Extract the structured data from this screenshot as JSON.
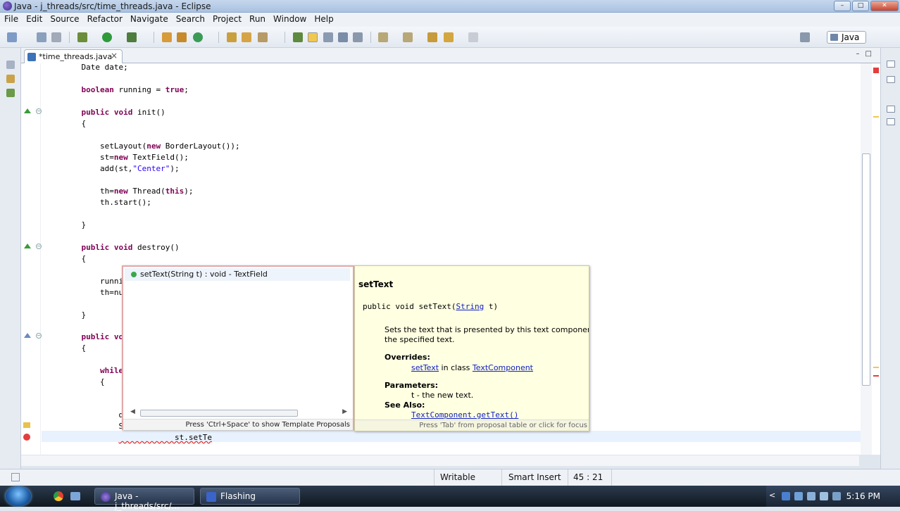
{
  "window": {
    "title": "Java - j_threads/src/time_threads.java - Eclipse"
  },
  "menu": [
    "File",
    "Edit",
    "Source",
    "Refactor",
    "Navigate",
    "Search",
    "Project",
    "Run",
    "Window",
    "Help"
  ],
  "perspective": {
    "label": "Java"
  },
  "editor": {
    "tab_label": "*time_threads.java",
    "code": [
      "    Date date;",
      "",
      "    boolean running = true;",
      "",
      "    public void init()",
      "    {",
      "",
      "        setLayout(new BorderLayout());",
      "        st=new TextField();",
      "        add(st,\"Center\");",
      "",
      "        th=new Thread(this);",
      "        th.start();",
      "",
      "    }",
      "",
      "    public void destroy()",
      "    {",
      "",
      "        running",
      "        th=null",
      "",
      "    }",
      "",
      "    public void",
      "    {",
      "",
      "        while(r",
      "        {",
      "",
      "",
      "            dat",
      "            Str",
      "            st.setTe"
    ]
  },
  "content_assist": {
    "proposal": "setText(String t) : void - TextField",
    "status": "Press 'Ctrl+Space' to show Template Proposals"
  },
  "javadoc": {
    "name": "setText",
    "signature_prefix": "public void setText(",
    "signature_type": "String",
    "signature_suffix": " t)",
    "desc_line1": "Sets the text that is presented by this text component to be",
    "desc_line2": "the specified text.",
    "overrides_label": "Overrides:",
    "overrides_method": "setText",
    "overrides_in": " in class ",
    "overrides_class": "TextComponent",
    "parameters_label": "Parameters:",
    "parameter": "t - the new text.",
    "see_also_label": "See Also:",
    "see_also": "TextComponent.getText()",
    "status": "Press 'Tab' from proposal table or click for focus"
  },
  "status_bar": {
    "writable": "Writable",
    "insert_mode": "Smart Insert",
    "position": "45 : 21"
  },
  "taskbar": {
    "buttons": [
      "Java - j_threads/src/...",
      "Flashing"
    ],
    "clock": "5:16 PM"
  },
  "colors": {
    "keyword": "#7f0055",
    "string": "#2a00ff",
    "javadoc_bg": "#ffffe1",
    "error": "#e53d3d"
  }
}
